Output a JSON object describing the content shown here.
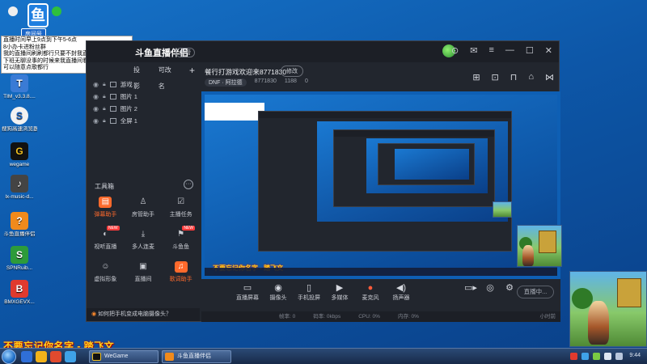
{
  "desktop": {
    "logo_badge": "房间号",
    "notice_lines": [
      "直播时间早上9点到下午5-6点",
      "8小办卡进粉丝群",
      "我的直播间刷刷都行只要不封我直播间就行",
      "下班无聊没事的时候来我直播间看看",
      "可以随意点歌都行"
    ],
    "icons": [
      {
        "label": "TIM_v3.3.8....",
        "color": "#3a7bd5",
        "glyph": "T"
      },
      {
        "label": "搜狗高速浏览器",
        "color": "#f2f2f2",
        "glyph": "S"
      },
      {
        "label": "wegame",
        "color": "#111111",
        "glyph": "G"
      },
      {
        "label": "lx-music-d...",
        "color": "#444444",
        "glyph": "♪"
      },
      {
        "label": "斗鱼直播伴侣",
        "color": "#f08a1c",
        "glyph": "?"
      },
      {
        "label": "SPNRuib...",
        "color": "#2d9b3a",
        "glyph": "S"
      },
      {
        "label": "BMXGEVX...",
        "color": "#e03a2e",
        "glyph": "B"
      }
    ],
    "caption": "不要忘记你名字 - 踏飞文"
  },
  "app": {
    "brand": "斗鱼直播伴侣",
    "version_badge": "房管",
    "left_tabs": [
      "投影",
      "可改名"
    ],
    "scenes": [
      "游戏",
      "图片 1",
      "图片 2",
      "全屏 1"
    ],
    "toolbox_title": "工具箱",
    "tools": [
      {
        "label": "弹幕助手",
        "highlight": true,
        "tag": ""
      },
      {
        "label": "房管助手",
        "highlight": false,
        "tag": ""
      },
      {
        "label": "主播任务",
        "highlight": false,
        "tag": ""
      },
      {
        "label": "视听直播",
        "highlight": false,
        "tag": "NEW"
      },
      {
        "label": "多人连麦",
        "highlight": false,
        "tag": ""
      },
      {
        "label": "斗鱼鱼",
        "highlight": false,
        "tag": "NEW"
      },
      {
        "label": "虚拟形象",
        "highlight": false,
        "tag": ""
      },
      {
        "label": "直播间",
        "highlight": false,
        "tag": ""
      },
      {
        "label": "歌词助手",
        "highlight": true,
        "tag": ""
      }
    ],
    "bottom_hint_prefix": "如何把手机变成电脑摄像头？",
    "room_title": "餐行打游戏欢迎来8771830",
    "edit_label": "修改",
    "room_game": "DNF · 阿拉德",
    "room_id": "8771830",
    "room_fans": "1188",
    "room_count": "0",
    "controls": [
      {
        "label": "直播屏幕",
        "glyph": "▭",
        "red": false
      },
      {
        "label": "摄像头",
        "glyph": "◉",
        "red": false
      },
      {
        "label": "手机投屏",
        "glyph": "▯",
        "red": false
      },
      {
        "label": "多媒体",
        "glyph": "▶",
        "red": false
      },
      {
        "label": "麦克风",
        "glyph": "●",
        "red": true
      },
      {
        "label": "扬声器",
        "glyph": "◀)",
        "red": false
      }
    ],
    "start_label": "直播中...",
    "status": [
      "帧率: 0",
      "码率: 0kbps",
      "CPU: 0%",
      "内存: 0%"
    ],
    "status_right": "小时前",
    "preview_caption": "不要忘记你名字 - 踏飞文"
  },
  "taskbar": {
    "buttons": [
      "WeGame",
      "斗鱼直播伴侣"
    ],
    "clock": "9:44"
  }
}
